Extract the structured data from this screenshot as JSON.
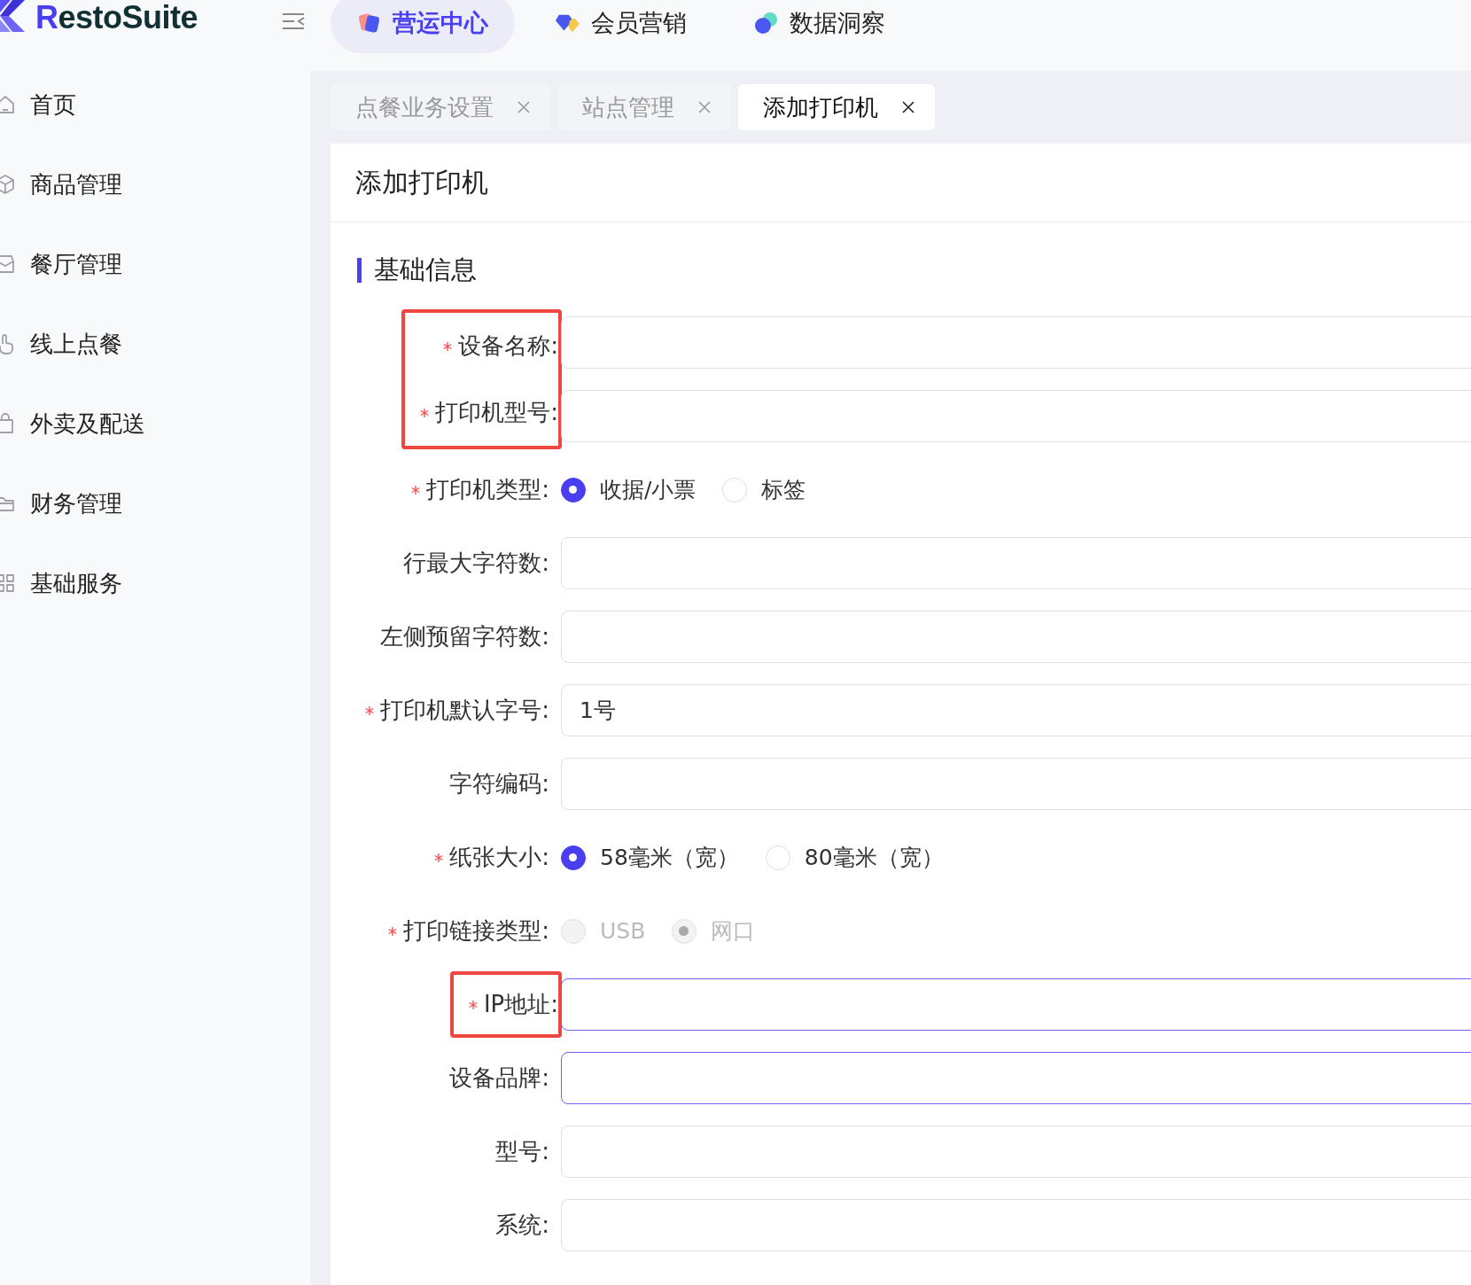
{
  "brand": {
    "name": "RestoSuite"
  },
  "top_nav": [
    {
      "label": "营运中心",
      "selected": true
    },
    {
      "label": "会员营销",
      "selected": false
    },
    {
      "label": "数据洞察",
      "selected": false
    }
  ],
  "sidebar": {
    "items": [
      {
        "label": "首页"
      },
      {
        "label": "商品管理"
      },
      {
        "label": "餐厅管理"
      },
      {
        "label": "线上点餐"
      },
      {
        "label": "外卖及配送"
      },
      {
        "label": "财务管理"
      },
      {
        "label": "基础服务"
      }
    ]
  },
  "tabs": [
    {
      "label": "点餐业务设置",
      "selected": false
    },
    {
      "label": "站点管理",
      "selected": false
    },
    {
      "label": "添加打印机",
      "selected": true
    }
  ],
  "page": {
    "title": "添加打印机",
    "section": "基础信息",
    "fields": [
      {
        "kind": "input",
        "label": "设备名称:",
        "required": true,
        "highlighted": true,
        "focused": false
      },
      {
        "kind": "input",
        "label": "打印机型号:",
        "required": true,
        "highlighted": true,
        "focused": false
      },
      {
        "kind": "radio",
        "label": "打印机类型:",
        "required": true,
        "highlighted": false,
        "disabled": false,
        "options": [
          {
            "label": "收据/小票",
            "selected": true
          },
          {
            "label": "标签",
            "selected": false
          }
        ]
      },
      {
        "kind": "input",
        "label": "行最大字符数:",
        "required": false,
        "highlighted": false,
        "focused": false
      },
      {
        "kind": "input",
        "label": "左侧预留字符数:",
        "required": false,
        "highlighted": false,
        "focused": false
      },
      {
        "kind": "input",
        "label": "打印机默认字号:",
        "required": true,
        "highlighted": false,
        "focused": false,
        "value": "1号"
      },
      {
        "kind": "input",
        "label": "字符编码:",
        "required": false,
        "highlighted": false,
        "focused": false
      },
      {
        "kind": "radio",
        "label": "纸张大小:",
        "required": true,
        "highlighted": false,
        "disabled": false,
        "options": [
          {
            "label": "58毫米（宽）",
            "selected": true
          },
          {
            "label": "80毫米（宽）",
            "selected": false
          }
        ]
      },
      {
        "kind": "radio",
        "label": "打印链接类型:",
        "required": true,
        "highlighted": false,
        "disabled": true,
        "options": [
          {
            "label": "USB",
            "selected": false
          },
          {
            "label": "网口",
            "selected": true
          }
        ]
      },
      {
        "kind": "input",
        "label": "IP地址:",
        "required": true,
        "highlighted": true,
        "focused": true
      },
      {
        "kind": "input",
        "label": "设备品牌:",
        "required": false,
        "highlighted": false,
        "focused": true
      },
      {
        "kind": "input",
        "label": "型号:",
        "required": false,
        "highlighted": false,
        "focused": false
      },
      {
        "kind": "input",
        "label": "系统:",
        "required": false,
        "highlighted": false,
        "focused": false
      }
    ]
  }
}
